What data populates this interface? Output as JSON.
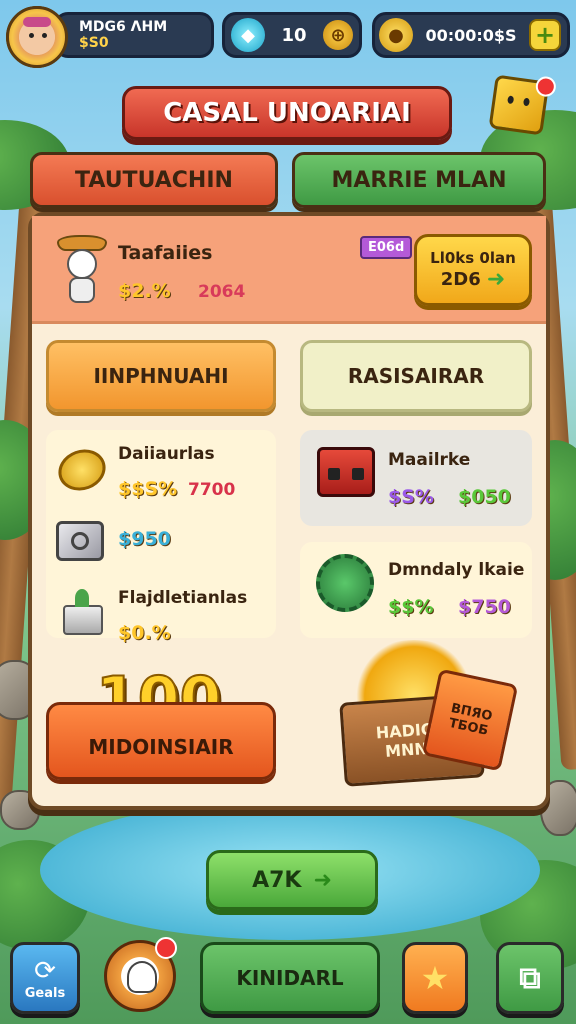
{
  "colors": {
    "accent_red": "#d8422f",
    "accent_green": "#4cae4c",
    "accent_orange": "#f28a3a",
    "panel_cream": "#fbeed8",
    "gold": "#f5c518"
  },
  "hud": {
    "player_name": "MDG6 ΛНM",
    "player_money": "$S0",
    "gems": "10",
    "timer": "00:00:0$S",
    "add_label": "+"
  },
  "title_banner": "CASAL UNOARIAI",
  "tabs": [
    {
      "label": "TAUTUACHIN"
    },
    {
      "label": "MARRIE MLAN"
    }
  ],
  "featured": {
    "name": "Taafaiies",
    "price": "$2.%",
    "sub_value": "2064",
    "badge": "E06d",
    "cta_label": "Ll0ks 0lan",
    "cta_value": "2D6"
  },
  "sections": [
    {
      "label": "IINPHNUAHI"
    },
    {
      "label": "RASISAIRAR"
    }
  ],
  "left_items": [
    {
      "name": "Daiiaurlas",
      "price": "$$S%",
      "value": "7700",
      "icon": "trophy-icon"
    },
    {
      "name": "",
      "price": "$950",
      "value": "",
      "icon": "safe-icon"
    },
    {
      "name": "Flajdletianlas",
      "price": "$0.%",
      "value": "",
      "icon": "plant-icon"
    }
  ],
  "right_items": [
    {
      "name": "Maailrke",
      "price": "$S%",
      "value": "$050",
      "icon": "chest-icon"
    },
    {
      "name": "Dmndaly lkaie",
      "price": "$$%",
      "value": "$750",
      "icon": "gear-monster-icon"
    }
  ],
  "reward": {
    "amount": "100",
    "button_label": "MIDOINSIAIR"
  },
  "treasure": {
    "sign_label": "HADIGU MNNK",
    "ticket_label": "ВПЯО ТБОБ"
  },
  "main_button": {
    "label": "A7K",
    "arrow": "➜"
  },
  "bottom_nav": [
    {
      "label": "Geals",
      "icon": "refresh-icon"
    },
    {
      "label": "",
      "icon": "ghost-avatar-icon"
    },
    {
      "label": "KINIDARL",
      "icon": ""
    },
    {
      "label": "",
      "icon": "star-icon"
    },
    {
      "label": "",
      "icon": "puzzle-icon"
    }
  ]
}
